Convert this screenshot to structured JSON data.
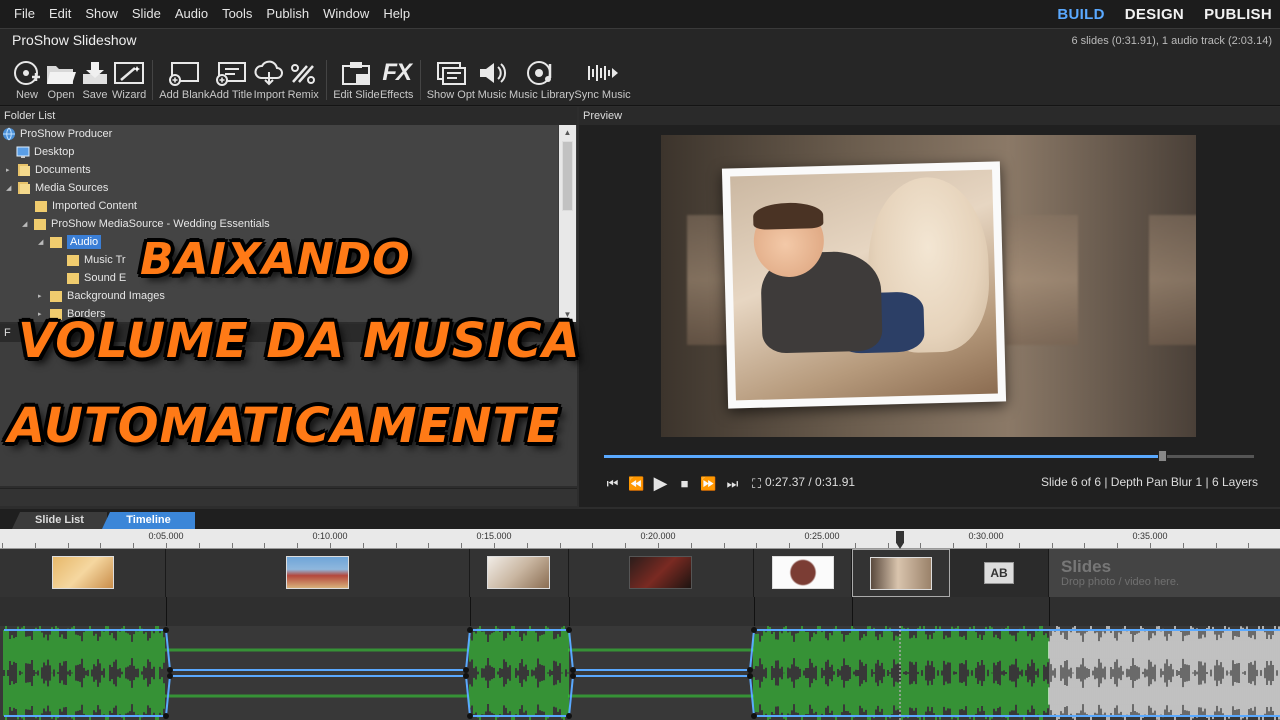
{
  "menu": [
    "File",
    "Edit",
    "Show",
    "Slide",
    "Audio",
    "Tools",
    "Publish",
    "Window",
    "Help"
  ],
  "modes": [
    {
      "label": "BUILD",
      "active": true
    },
    {
      "label": "DESIGN",
      "active": false
    },
    {
      "label": "PUBLISH",
      "active": false
    }
  ],
  "app_title": "ProShow Slideshow",
  "show_info": "6 slides (0:31.91), 1 audio track (2:03.14)",
  "toolbar": {
    "new": "New",
    "open": "Open",
    "save": "Save",
    "wizard": "Wizard",
    "add_blank": "Add Blank",
    "add_title": "Add Title",
    "import": "Import",
    "remix": "Remix",
    "edit_slide": "Edit Slide",
    "effects": "Effects",
    "effects_icon_text": "FX",
    "show_opt": "Show Opt",
    "music": "Music",
    "music_library": "Music Library",
    "sync_music": "Sync Music"
  },
  "folder_list": {
    "title": "Folder List",
    "items": [
      {
        "label": "ProShow Producer"
      },
      {
        "label": "Desktop"
      },
      {
        "label": "Documents"
      },
      {
        "label": "Media Sources"
      },
      {
        "label": "Imported Content"
      },
      {
        "label": "ProShow MediaSource - Wedding Essentials"
      },
      {
        "label": "Audio"
      },
      {
        "label": "Music Tr"
      },
      {
        "label": "Sound E"
      },
      {
        "label": "Background Images"
      },
      {
        "label": "Borders"
      }
    ]
  },
  "file_panel_letter": "F",
  "overlay": {
    "line1": "BAIXANDO",
    "line2": "VOLUME DA MUSICA",
    "line3": "AUTOMATICAMENTE"
  },
  "preview": {
    "title": "Preview",
    "time": "0:27.37 / 0:31.91",
    "slide_info": "Slide 6 of 6  |  Depth Pan Blur 1  |  6 Layers",
    "progress": 0.858
  },
  "tabs": {
    "slide_list": "Slide List",
    "timeline": "Timeline"
  },
  "ruler": [
    "0:05.000",
    "0:10.000",
    "0:15.000",
    "0:20.000",
    "0:25.000",
    "0:30.000",
    "0:35.000"
  ],
  "drop_area": {
    "title": "Slides",
    "hint": "Drop photo / video here."
  },
  "colors": {
    "accent": "#5aa9ff",
    "overlay_text": "#ff7a16",
    "waveform": "#35b935"
  }
}
